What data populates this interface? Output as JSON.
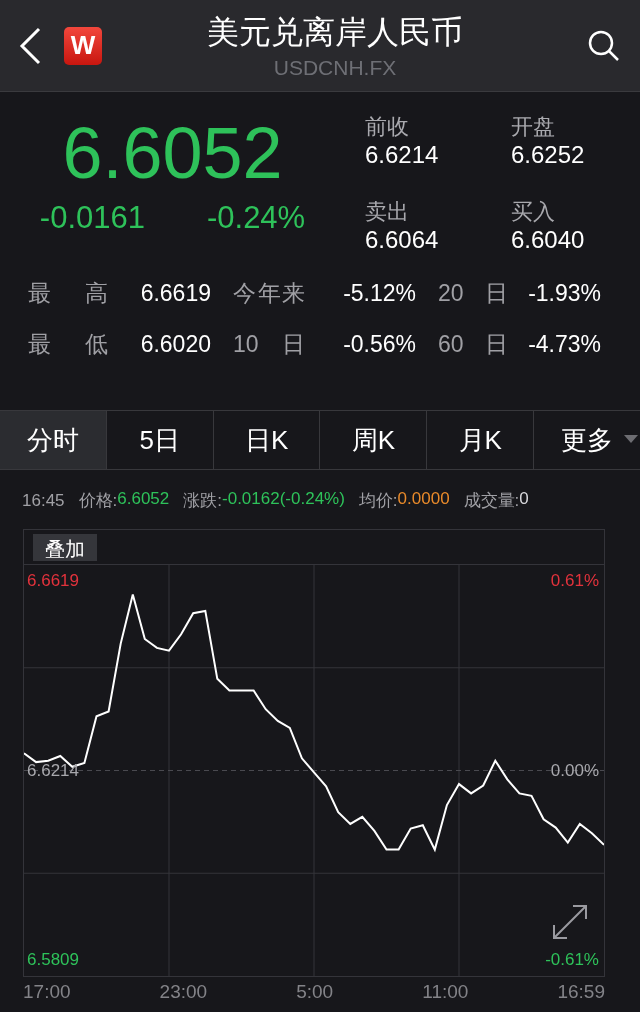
{
  "header": {
    "logo": "W",
    "title": "美元兑离岸人民币",
    "subtitle": "USDCNH.FX"
  },
  "quote": {
    "price": "6.6052",
    "change": "-0.0161",
    "change_pct": "-0.24%",
    "kind": "down",
    "fields": [
      {
        "label": "前收",
        "value": "6.6214"
      },
      {
        "label": "开盘",
        "value": "6.6252"
      },
      {
        "label": "卖出",
        "value": "6.6064"
      },
      {
        "label": "买入",
        "value": "6.6040"
      }
    ]
  },
  "stats": [
    {
      "label": "最 高",
      "value": "6.6619"
    },
    {
      "label": "今年来",
      "value": "-5.12%"
    },
    {
      "label": "20 日",
      "value": "-1.93%"
    },
    {
      "label": "最 低",
      "value": "6.6020"
    },
    {
      "label": "10 日",
      "value": "-0.56%"
    },
    {
      "label": "60 日",
      "value": "-4.73%"
    }
  ],
  "tabs": [
    {
      "label": "分时",
      "selected": true,
      "dropdown": false
    },
    {
      "label": "5日",
      "selected": false,
      "dropdown": false
    },
    {
      "label": "日K",
      "selected": false,
      "dropdown": false
    },
    {
      "label": "周K",
      "selected": false,
      "dropdown": false
    },
    {
      "label": "月K",
      "selected": false,
      "dropdown": false
    },
    {
      "label": "更多",
      "selected": false,
      "dropdown": true
    }
  ],
  "info_bar": {
    "time": "16:45",
    "items": [
      {
        "label": "价格:",
        "value": "6.6052",
        "kind": "down"
      },
      {
        "label": "涨跌:",
        "value": "-0.0162(-0.24%)",
        "kind": "down"
      },
      {
        "label": "均价:",
        "value": "0.0000",
        "kind": "average"
      },
      {
        "label": "成交量:",
        "value": "0",
        "kind": "flat"
      }
    ]
  },
  "chart": {
    "overlay_button": "叠加",
    "right_labels": [
      {
        "text": "0.61%",
        "kind": "up"
      },
      {
        "text": "0.00%",
        "kind": "flat"
      },
      {
        "text": "-0.61%",
        "kind": "down"
      }
    ],
    "time_labels": [
      "17:00",
      "23:00",
      "5:00",
      "11:00",
      "16:59"
    ],
    "chart_data": {
      "type": "line",
      "grid": true,
      "ref_lines": [
        {
          "axis": "y",
          "value": 6.6214
        }
      ],
      "series": [
        {
          "color": "#ffffff",
          "values": [
            6.6251,
            6.6232,
            6.6235,
            6.6245,
            6.6222,
            6.623,
            6.633,
            6.634,
            6.6485,
            6.659,
            6.6495,
            6.6476,
            6.647,
            6.6505,
            6.655,
            6.6555,
            6.641,
            6.6385,
            6.6385,
            6.6385,
            6.6345,
            6.632,
            6.6305,
            6.624,
            6.621,
            6.618,
            6.6125,
            6.61,
            6.6115,
            6.6085,
            6.6045,
            6.6045,
            6.609,
            6.6097,
            6.6045,
            6.614,
            6.6185,
            6.6165,
            6.6182,
            6.6235,
            6.6195,
            6.6165,
            6.616,
            6.611,
            6.6092,
            6.606,
            6.61,
            6.608,
            6.6055
          ]
        }
      ],
      "ylim": [
        6.5775,
        6.6653
      ],
      "yticks": [
        {
          "value": 6.6619,
          "label": "6.6619"
        },
        {
          "value": 6.6214,
          "label": "6.6214"
        },
        {
          "value": 6.5809,
          "label": "6.5809"
        }
      ]
    }
  }
}
